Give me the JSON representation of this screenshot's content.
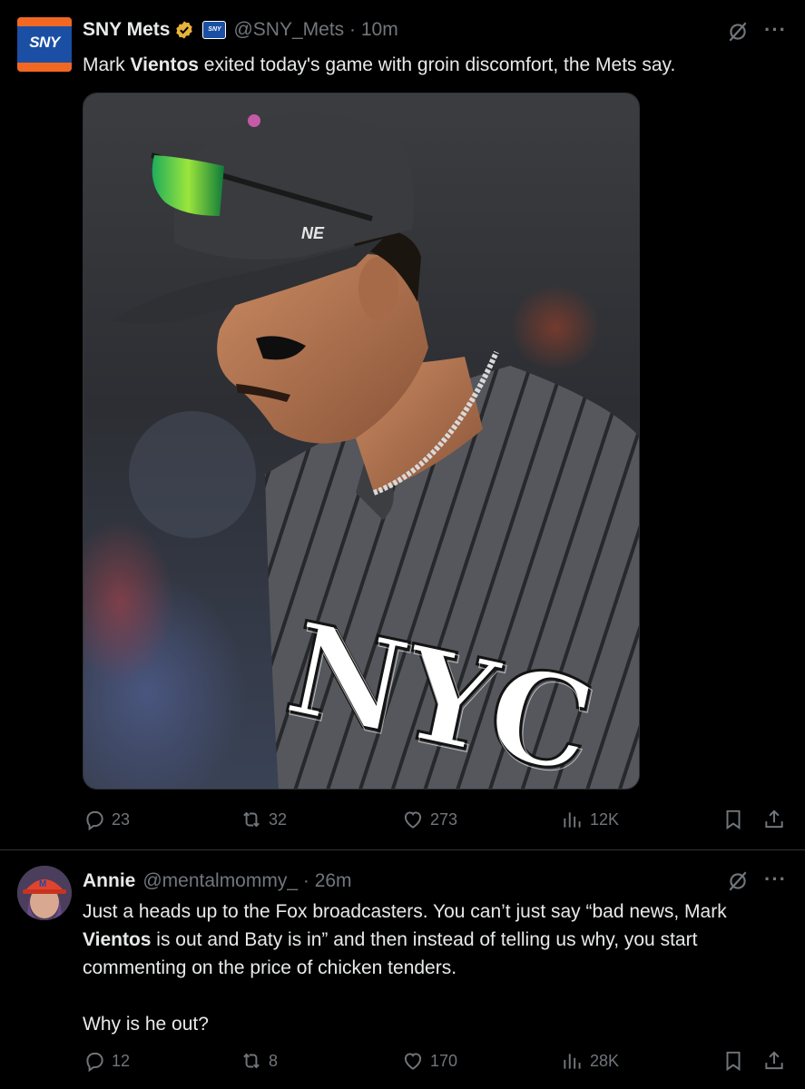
{
  "tweet1": {
    "author_name": "SNY Mets",
    "avatar_text": "SNY",
    "affiliate_badge": "SNY",
    "handle_time": "@SNY_Mets · 10m",
    "text_parts": [
      "Mark ",
      "Vientos",
      " exited today's game with groin discomfort, the Mets say."
    ],
    "media_letters": "NYC",
    "actions": {
      "replies": "23",
      "reposts": "32",
      "likes": "273",
      "views": "12K"
    }
  },
  "tweet2": {
    "author_name": "Annie",
    "handle_time": "@mentalmommy_ · 26m",
    "text_parts": [
      "Just a heads up to the Fox broadcasters. You can’t just say “bad news, Mark\n",
      "Vientos",
      " is out and Baty is in” and then instead of telling us why, you start\ncommenting on the price of chicken tenders.\n\nWhy is he out?"
    ],
    "actions": {
      "replies": "12",
      "reposts": "8",
      "likes": "170",
      "views": "28K"
    }
  },
  "colors": {
    "background": "#000000",
    "text": "#e7e9ea",
    "muted": "#71767b",
    "verified": "#e8b339",
    "divider": "#2f3336"
  },
  "icons": [
    "grok-icon",
    "more-icon",
    "reply-icon",
    "repost-icon",
    "like-icon",
    "views-icon",
    "bookmark-icon",
    "share-icon",
    "verified-badge-icon"
  ]
}
